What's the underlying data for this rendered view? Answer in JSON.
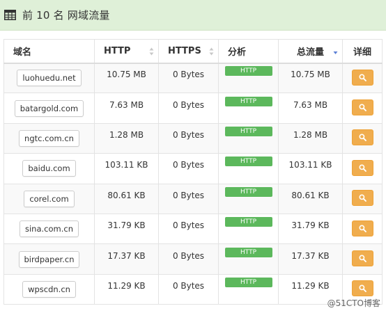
{
  "panel": {
    "title": "前 10 名 网域流量",
    "icon": "table-icon"
  },
  "table": {
    "headers": {
      "domain": "域名",
      "http": "HTTP",
      "https": "HTTPS",
      "analysis": "分析",
      "total": "总流量",
      "detail": "详细"
    },
    "sort": {
      "column": "总流量",
      "direction": "descending"
    },
    "rows": [
      {
        "domain": "luohuedu.net",
        "http": "10.75 MB",
        "https": "0 Bytes",
        "protocol": "HTTP",
        "total": "10.75 MB"
      },
      {
        "domain": "batargold.com",
        "http": "7.63 MB",
        "https": "0 Bytes",
        "protocol": "HTTP",
        "total": "7.63 MB"
      },
      {
        "domain": "ngtc.com.cn",
        "http": "1.28 MB",
        "https": "0 Bytes",
        "protocol": "HTTP",
        "total": "1.28 MB"
      },
      {
        "domain": "baidu.com",
        "http": "103.11 KB",
        "https": "0 Bytes",
        "protocol": "HTTP",
        "total": "103.11 KB"
      },
      {
        "domain": "corel.com",
        "http": "80.61 KB",
        "https": "0 Bytes",
        "protocol": "HTTP",
        "total": "80.61 KB"
      },
      {
        "domain": "sina.com.cn",
        "http": "31.79 KB",
        "https": "0 Bytes",
        "protocol": "HTTP",
        "total": "31.79 KB"
      },
      {
        "domain": "birdpaper.cn",
        "http": "17.37 KB",
        "https": "0 Bytes",
        "protocol": "HTTP",
        "total": "17.37 KB"
      },
      {
        "domain": "wpscdn.cn",
        "http": "11.29 KB",
        "https": "0 Bytes",
        "protocol": "HTTP",
        "total": "11.29 KB"
      }
    ]
  },
  "colors": {
    "heading_bg": "#dff0d8",
    "label_success": "#5cb85c",
    "button_warning": "#f0ad4e",
    "sort_active": "#5b7fd6"
  },
  "watermark": "@51CTO博客"
}
